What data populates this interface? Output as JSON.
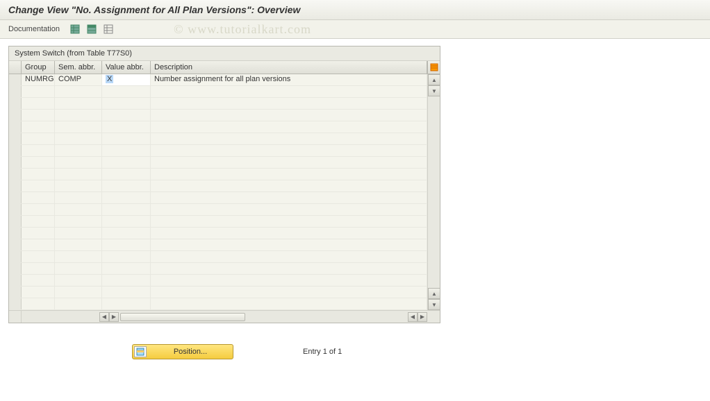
{
  "title": "Change View \"No. Assignment for All Plan Versions\": Overview",
  "watermark": "© www.tutorialkart.com",
  "toolbar": {
    "documentation_label": "Documentation"
  },
  "panel": {
    "title": "System Switch (from Table T77S0)"
  },
  "columns": {
    "group": "Group",
    "sem_abbr": "Sem. abbr.",
    "value_abbr": "Value abbr.",
    "description": "Description"
  },
  "rows": [
    {
      "group": "NUMRG",
      "sem_abbr": "COMP",
      "value_abbr": "X",
      "description": "Number assignment for all plan versions"
    }
  ],
  "footer": {
    "position_label": "Position...",
    "entry_text": "Entry 1 of 1"
  }
}
